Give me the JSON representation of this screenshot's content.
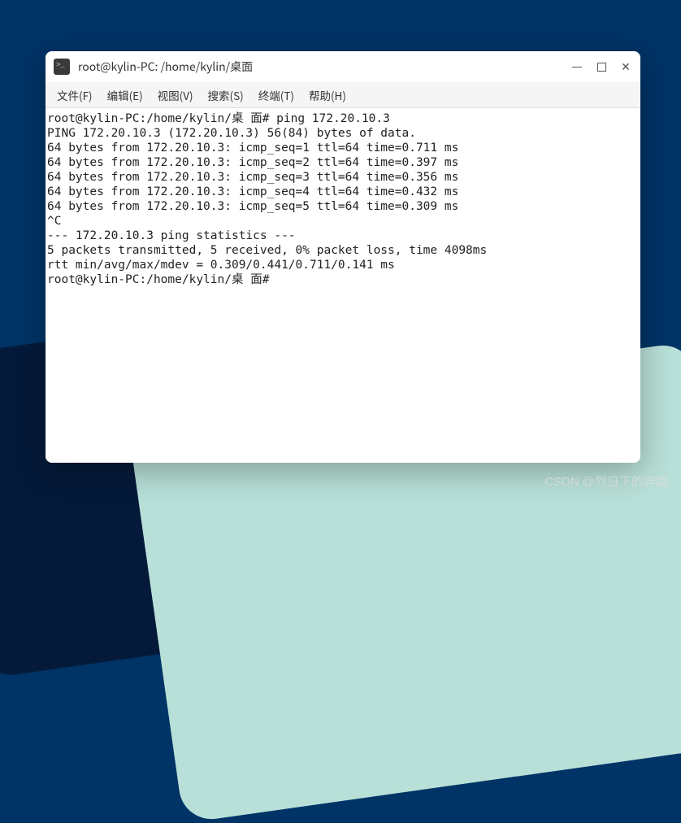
{
  "window": {
    "title": "root@kylin-PC: /home/kylin/桌面"
  },
  "menu": {
    "file": "文件(F)",
    "edit": "编辑(E)",
    "view": "视图(V)",
    "search": "搜索(S)",
    "terminal": "终端(T)",
    "help": "帮助(H)"
  },
  "terminal": {
    "lines": [
      "root@kylin-PC:/home/kylin/桌 面# ping 172.20.10.3",
      "PING 172.20.10.3 (172.20.10.3) 56(84) bytes of data.",
      "64 bytes from 172.20.10.3: icmp_seq=1 ttl=64 time=0.711 ms",
      "64 bytes from 172.20.10.3: icmp_seq=2 ttl=64 time=0.397 ms",
      "64 bytes from 172.20.10.3: icmp_seq=3 ttl=64 time=0.356 ms",
      "64 bytes from 172.20.10.3: icmp_seq=4 ttl=64 time=0.432 ms",
      "64 bytes from 172.20.10.3: icmp_seq=5 ttl=64 time=0.309 ms",
      "^C",
      "--- 172.20.10.3 ping statistics ---",
      "5 packets transmitted, 5 received, 0% packet loss, time 4098ms",
      "rtt min/avg/max/mdev = 0.309/0.441/0.711/0.141 ms",
      "root@kylin-PC:/home/kylin/桌 面#"
    ]
  },
  "watermark": "CSDN @烈日下的奔跑"
}
